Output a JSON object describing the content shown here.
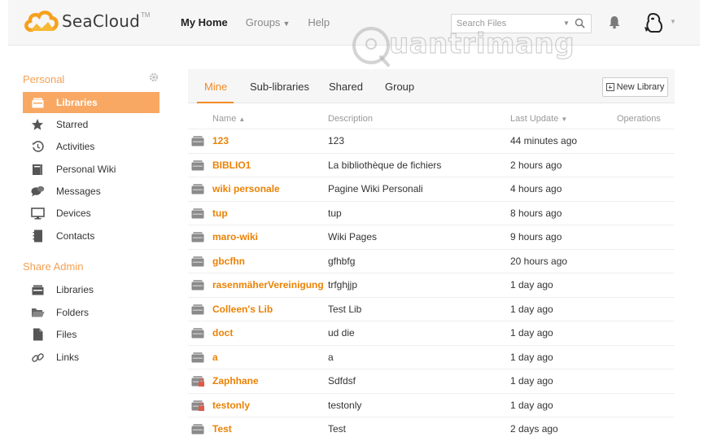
{
  "header": {
    "logo_text": "SeaCloud",
    "logo_tm": "TM",
    "nav": [
      {
        "label": "My Home"
      },
      {
        "label": "Groups"
      },
      {
        "label": "Help"
      }
    ],
    "search_placeholder": "Search Files"
  },
  "watermark_text": "uantrimang",
  "sidebar": {
    "personal_heading": "Personal",
    "personal_items": [
      {
        "label": "Libraries",
        "icon": "library-icon"
      },
      {
        "label": "Starred",
        "icon": "star-icon"
      },
      {
        "label": "Activities",
        "icon": "clock-icon"
      },
      {
        "label": "Personal Wiki",
        "icon": "wiki-icon"
      },
      {
        "label": "Messages",
        "icon": "messages-icon"
      },
      {
        "label": "Devices",
        "icon": "monitor-icon"
      },
      {
        "label": "Contacts",
        "icon": "contacts-icon"
      }
    ],
    "share_admin_heading": "Share Admin",
    "share_items": [
      {
        "label": "Libraries",
        "icon": "library-icon"
      },
      {
        "label": "Folders",
        "icon": "folder-icon"
      },
      {
        "label": "Files",
        "icon": "file-icon"
      },
      {
        "label": "Links",
        "icon": "link-icon"
      }
    ]
  },
  "tabs": [
    {
      "label": "Mine"
    },
    {
      "label": "Sub-libraries"
    },
    {
      "label": "Shared"
    },
    {
      "label": "Group"
    }
  ],
  "new_library_label": "New Library",
  "table": {
    "columns": {
      "name": "Name",
      "description": "Description",
      "last_update": "Last Update",
      "operations": "Operations"
    },
    "rows": [
      {
        "name": "123",
        "description": "123",
        "last_update": "44 minutes ago",
        "locked": false
      },
      {
        "name": "BIBLIO1",
        "description": "La bibliothèque de fichiers",
        "last_update": "2 hours ago",
        "locked": false
      },
      {
        "name": "wiki personale",
        "description": "Pagine Wiki Personali",
        "last_update": "4 hours ago",
        "locked": false
      },
      {
        "name": "tup",
        "description": "tup",
        "last_update": "8 hours ago",
        "locked": false
      },
      {
        "name": "maro-wiki",
        "description": "Wiki Pages",
        "last_update": "9 hours ago",
        "locked": false
      },
      {
        "name": "gbcfhn",
        "description": "gfhbfg",
        "last_update": "20 hours ago",
        "locked": false
      },
      {
        "name": "rasenmäherVereinigung",
        "description": "trfghjjp",
        "last_update": "1 day ago",
        "locked": false
      },
      {
        "name": "Colleen's Lib",
        "description": "Test Lib",
        "last_update": "1 day ago",
        "locked": false
      },
      {
        "name": "doct",
        "description": "ud die",
        "last_update": "1 day ago",
        "locked": false
      },
      {
        "name": "a",
        "description": "a",
        "last_update": "1 day ago",
        "locked": false
      },
      {
        "name": "Zaphhane",
        "description": "Sdfdsf",
        "last_update": "1 day ago",
        "locked": true
      },
      {
        "name": "testonly",
        "description": "testonly",
        "last_update": "1 day ago",
        "locked": true
      },
      {
        "name": "Test",
        "description": "Test",
        "last_update": "2 days ago",
        "locked": false
      }
    ]
  },
  "colors": {
    "accent": "#f08a24",
    "sidebar_active": "#f8a863",
    "heading_orange": "#f3a154",
    "link_orange": "#eb8205"
  }
}
